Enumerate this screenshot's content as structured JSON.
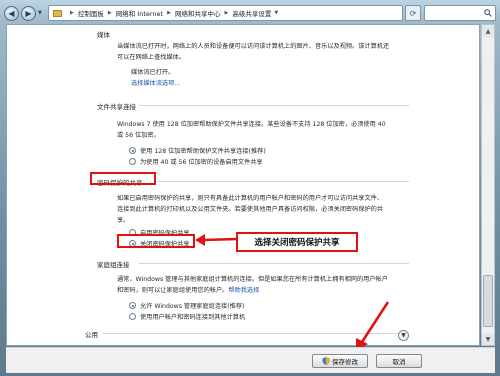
{
  "breadcrumb": [
    "控制面板",
    "网络和 Internet",
    "网络和共享中心",
    "高级共享设置"
  ],
  "colors": {
    "highlight": "#e01212",
    "link": "#1a56a8"
  },
  "media": {
    "top_fragment": "媒体",
    "desc_line1": "当媒体流已打开时，网络上的人员和设备便可以访问该计算机上的图片、音乐以及视频。该计算机还",
    "desc_line2": "可以在网络上查找媒体。",
    "status": "媒体流已打开。",
    "link": "选择媒体流选项..."
  },
  "file_sharing": {
    "title": "文件共享连接",
    "desc_line1": "Windows 7 使用 128 位加密帮助保护文件共享连接。某些设备不支持 128 位加密，必须使用 40",
    "desc_line2": "或 56 位加密。",
    "options": [
      {
        "label": "使用 128 位加密帮助保护文件共享连接(推荐)",
        "selected": true
      },
      {
        "label": "为使用 40 或 56 位加密的设备启用文件共享",
        "selected": false
      }
    ]
  },
  "password_sharing": {
    "title": "密码保护的共享",
    "desc_line1": "如果已启用密码保护的共享，则只有具备此计算机的用户帐户和密码的用户才可以访问共享文件、",
    "desc_line2": "连接到此计算机的打印机以及公用文件夹。若要使其他用户具备访问权限，必须关闭密码保护的共",
    "desc_line3": "享。",
    "options": [
      {
        "label": "启用密码保护共享",
        "selected": false
      },
      {
        "label": "关闭密码保护共享",
        "selected": true
      }
    ],
    "callout": "选择关闭密码保护共享"
  },
  "homegroup": {
    "title": "家庭组连接",
    "desc_line1": "通常，Windows 管理与其他家庭组计算机的连接。但是如果您在所有计算机上拥有相同的用户帐户",
    "desc_line2": "和密码，则可以让家庭组使用您的帐户。",
    "help_link": "帮助我选择",
    "options": [
      {
        "label": "允许 Windows 管理家庭组连接(推荐)",
        "selected": true
      },
      {
        "label": "使用用户帐户和密码连接到其他计算机",
        "selected": false
      }
    ]
  },
  "public_section": {
    "title": "公用"
  },
  "footer": {
    "save_label": "保存修改",
    "cancel_label": "取消"
  },
  "icons": {
    "back": "back-arrow-icon",
    "forward": "forward-arrow-icon",
    "refresh": "refresh-icon",
    "search": "search-icon",
    "shield": "uac-shield-icon",
    "expand": "chevron-down-icon"
  }
}
